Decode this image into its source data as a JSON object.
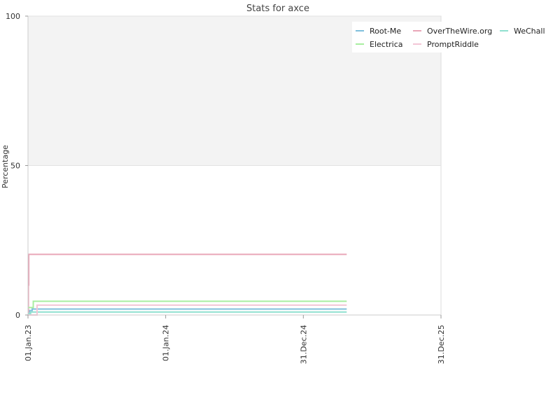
{
  "chart_data": {
    "type": "line",
    "title": "Stats for axce",
    "xlabel": "",
    "ylabel": "Percentage",
    "ylim": [
      0,
      100
    ],
    "yticks": [
      "0",
      "50",
      "100"
    ],
    "xlim": [
      "2023-01-01",
      "2025-12-31"
    ],
    "xticks": [
      {
        "date": "2023-01-01",
        "label": "01.Jan.23"
      },
      {
        "date": "2024-01-01",
        "label": "01.Jan.24"
      },
      {
        "date": "2024-12-31",
        "label": "31.Dec.24"
      },
      {
        "date": "2025-12-31",
        "label": "31.Dec.25"
      }
    ],
    "grid": true,
    "legend_position": "top-right",
    "background_band": {
      "from": 50,
      "to": 100,
      "color": "#f3f3f3"
    },
    "series": [
      {
        "name": "Root-Me",
        "color": "#7fbfdc",
        "points": [
          [
            "2023-01-01",
            1.0
          ],
          [
            "2023-01-05",
            1.5
          ],
          [
            "2023-01-12",
            2.0
          ],
          [
            "2025-04-25",
            2.0
          ]
        ]
      },
      {
        "name": "OverTheWire.org",
        "color": "#e9a6b8",
        "points": [
          [
            "2023-01-01",
            0.0
          ],
          [
            "2023-01-02",
            10.0
          ],
          [
            "2023-01-03",
            20.3
          ],
          [
            "2025-04-25",
            20.3
          ]
        ]
      },
      {
        "name": "WeChall",
        "color": "#8fe0cf",
        "points": [
          [
            "2023-01-01",
            0.5
          ],
          [
            "2023-01-08",
            1.0
          ],
          [
            "2025-04-25",
            1.0
          ]
        ]
      },
      {
        "name": "Electrica",
        "color": "#a8eea0",
        "points": [
          [
            "2023-01-01",
            2.5
          ],
          [
            "2023-01-14",
            2.5
          ],
          [
            "2023-01-15",
            4.6
          ],
          [
            "2025-04-25",
            4.6
          ]
        ]
      },
      {
        "name": "PromptRiddle",
        "color": "#f3c6d6",
        "points": [
          [
            "2023-01-01",
            0.0
          ],
          [
            "2023-01-24",
            0.0
          ],
          [
            "2023-01-25",
            3.3
          ],
          [
            "2025-04-25",
            3.3
          ]
        ]
      }
    ]
  }
}
